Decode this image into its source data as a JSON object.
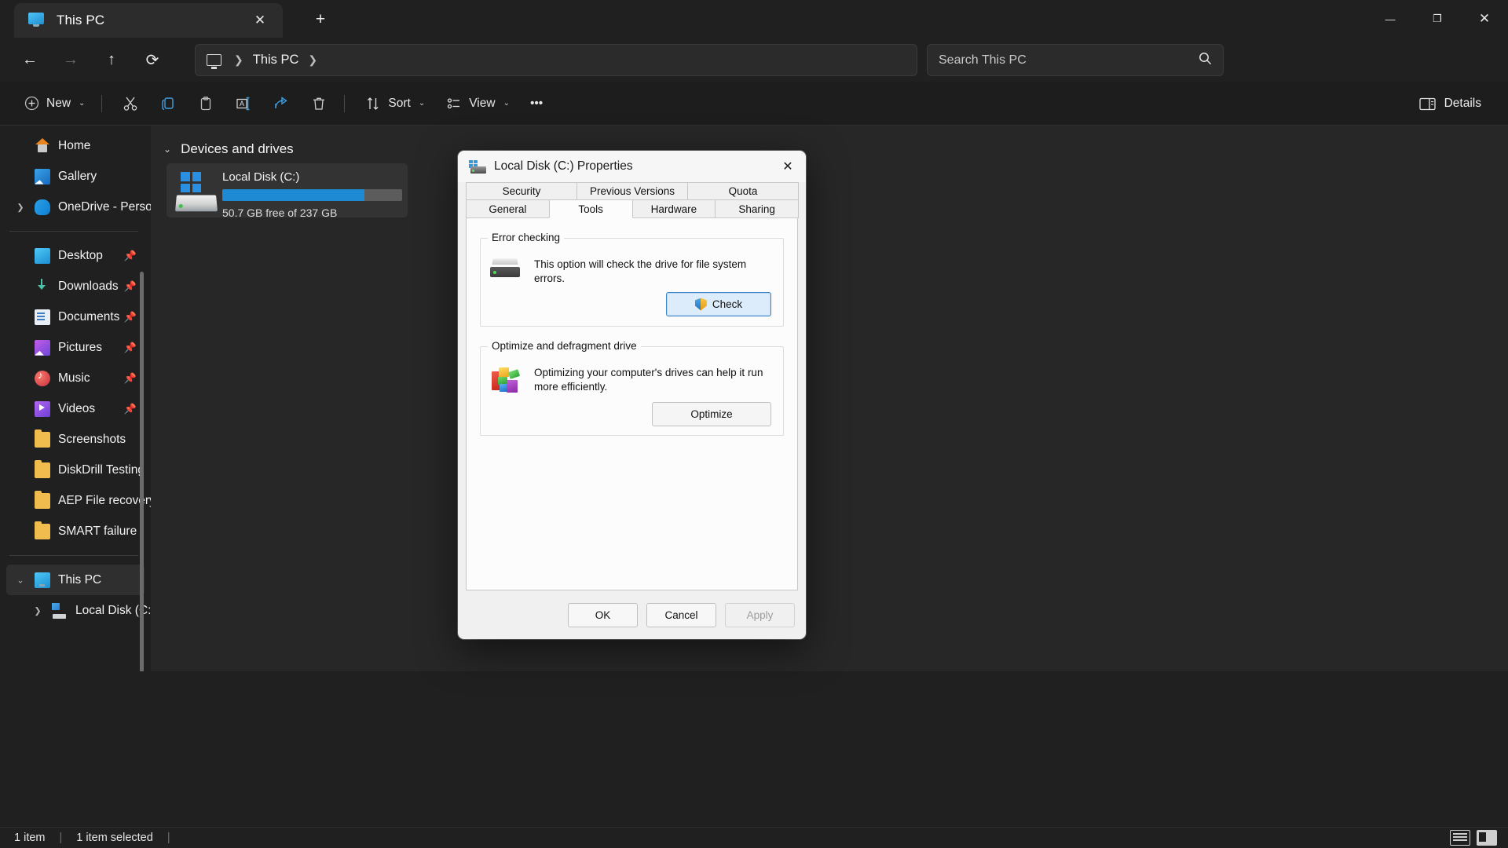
{
  "window": {
    "tab_title": "This PC",
    "tab_icon": "monitor-icon",
    "close_tab_label": "✕",
    "new_tab_label": "+",
    "minimize_label": "—",
    "maximize_label": "❐",
    "close_label": "✕"
  },
  "nav": {
    "back": "←",
    "forward": "→",
    "up": "↑",
    "refresh": "⟳",
    "breadcrumb_root_icon": "monitor-icon",
    "breadcrumb_sep1": "❯",
    "breadcrumb_item": "This PC",
    "breadcrumb_sep2": "❯"
  },
  "search": {
    "placeholder": "Search This PC",
    "icon": "search-icon"
  },
  "toolbar": {
    "new_label": "New",
    "new_chevron": "⌄",
    "cut_icon": "scissors-icon",
    "copy_icon": "copy-icon",
    "paste_icon": "clipboard-icon",
    "rename_icon": "rename-icon",
    "share_icon": "share-icon",
    "delete_icon": "trash-icon",
    "sort_label": "Sort",
    "sort_chevron": "⌄",
    "view_label": "View",
    "view_chevron": "⌄",
    "more_label": "•••",
    "details_label": "Details",
    "details_icon": "details-pane-icon"
  },
  "sidebar": {
    "items": [
      {
        "label": "Home",
        "icon": "home-icon",
        "expander": "",
        "pin": "",
        "selected": false
      },
      {
        "label": "Gallery",
        "icon": "gallery-icon",
        "expander": "",
        "pin": "",
        "selected": false
      },
      {
        "label": "OneDrive - Perso",
        "icon": "onedrive-icon",
        "expander": "❯",
        "pin": "",
        "selected": false
      }
    ],
    "pinned": [
      {
        "label": "Desktop",
        "icon": "desktop-icon",
        "pin": "📌"
      },
      {
        "label": "Downloads",
        "icon": "downloads-icon",
        "pin": "📌"
      },
      {
        "label": "Documents",
        "icon": "documents-icon",
        "pin": "📌"
      },
      {
        "label": "Pictures",
        "icon": "pictures-icon",
        "pin": "📌"
      },
      {
        "label": "Music",
        "icon": "music-icon",
        "pin": "📌"
      },
      {
        "label": "Videos",
        "icon": "videos-icon",
        "pin": "📌"
      },
      {
        "label": "Screenshots",
        "icon": "folder-icon",
        "pin": ""
      },
      {
        "label": "DiskDrill Testing",
        "icon": "folder-icon",
        "pin": ""
      },
      {
        "label": "AEP File recovery",
        "icon": "folder-icon",
        "pin": ""
      },
      {
        "label": "SMART failure",
        "icon": "folder-icon",
        "pin": ""
      }
    ],
    "tree": [
      {
        "label": "This PC",
        "icon": "pc-icon",
        "expander": "⌄",
        "selected": true
      },
      {
        "label": "Local Disk (C:)",
        "icon": "drive-icon",
        "expander": "❯",
        "selected": false
      }
    ]
  },
  "main": {
    "group_chevron": "⌄",
    "group_title": "Devices and drives",
    "drive": {
      "name": "Local Disk (C:)",
      "free_text": "50.7 GB free of 237 GB",
      "used_percent": 79,
      "bar_color": "#1f8ad4",
      "icon": "windows-drive-icon"
    }
  },
  "status": {
    "item_count": "1 item",
    "selection": "1 item selected",
    "separator": "|",
    "view_list_icon": "list-view-icon",
    "view_tiles_icon": "tiles-view-icon"
  },
  "dialog": {
    "title": "Local Disk (C:) Properties",
    "icon": "drive-properties-icon",
    "close_label": "✕",
    "tabs_row1": [
      {
        "label": "Security",
        "active": false
      },
      {
        "label": "Previous Versions",
        "active": false
      },
      {
        "label": "Quota",
        "active": false
      }
    ],
    "tabs_row2": [
      {
        "label": "General",
        "active": false
      },
      {
        "label": "Tools",
        "active": true
      },
      {
        "label": "Hardware",
        "active": false
      },
      {
        "label": "Sharing",
        "active": false
      }
    ],
    "error_checking": {
      "legend": "Error checking",
      "description": "This option will check the drive for file system errors.",
      "button_label": "Check",
      "button_icon": "shield-icon",
      "icon": "hdd-icon"
    },
    "optimize": {
      "legend": "Optimize and defragment drive",
      "description": "Optimizing your computer's drives can help it run more efficiently.",
      "button_label": "Optimize",
      "icon": "defrag-icon"
    },
    "footer": {
      "ok": "OK",
      "cancel": "Cancel",
      "apply": "Apply"
    }
  }
}
